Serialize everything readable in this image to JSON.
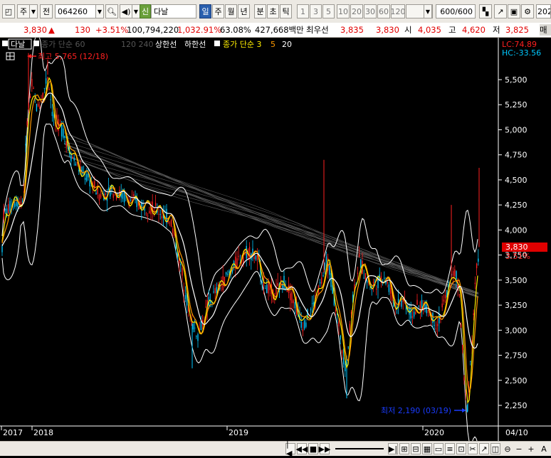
{
  "toolbar": {
    "period_button": "주",
    "prev_button": "전",
    "code_value": "064260",
    "stock_label": "신",
    "stock_name": "다날",
    "periods": [
      "일",
      "주",
      "월",
      "년",
      "분",
      "초",
      "틱"
    ],
    "intervals": [
      "1",
      "3",
      "5",
      "10",
      "20",
      "30",
      "60",
      "120"
    ],
    "count_value": "600",
    "count_total": "/600",
    "date_partial": "202"
  },
  "quote": {
    "price": "3,830",
    "change_arrow": "▲",
    "change": "130",
    "change_pct": "+3.51%",
    "volume": "100,794,220",
    "volume_pct": "1,032.91%",
    "turnover_pct": "63.08%",
    "amount": "427,668백만",
    "best_label": "최우선",
    "ask": "3,835",
    "bid": "3,830",
    "open_label": "시",
    "open": "4,035",
    "high_label": "고",
    "high": "4,620",
    "low_label": "저",
    "low": "3,825",
    "trade_label": "매"
  },
  "chart": {
    "stock_tag": "다날",
    "legend": {
      "price_ma": "종가 단순 60",
      "price_ma_faded": "120 240",
      "upper_limit": "상한선",
      "lower_limit": "하한선",
      "ma_label": "종가 단순 3",
      "ma_5": "5",
      "ma_20": "20"
    },
    "high_annotation": "최고 5,765 (12/18)",
    "low_annotation": "최저 2,190 (03/19)",
    "lc_value": "LC:74.89",
    "hc_value": "HC:-33.56",
    "current_price": "3,830",
    "current_pct": "3.51%",
    "y_ticks": [
      "5,500",
      "5,250",
      "5,000",
      "4,750",
      "4,500",
      "4,250",
      "4,000",
      "3,750",
      "3,500",
      "3,250",
      "3,000",
      "2,750",
      "2,500",
      "2,250"
    ],
    "x_ticks": [
      "2017",
      "2018",
      "2019",
      "2020"
    ],
    "date_label": "04/10",
    "colors": {
      "up": "#ff2020",
      "down": "#00c8ff",
      "ma3": "#ffee00",
      "ma5": "#ff9900",
      "ma20": "#ffffff",
      "envelope": "#ffffff",
      "accent": "#ff0000",
      "annotation_low": "#1a3cff"
    }
  },
  "chart_data": {
    "type": "line",
    "title": "",
    "xlabel": "",
    "ylabel": "",
    "ylim": [
      2100,
      5900
    ],
    "x": [
      "2017",
      "2018",
      "2019",
      "2020"
    ],
    "series": [
      {
        "name": "종가 단순 3",
        "values": [
          4100,
          5000,
          3800,
          3830
        ]
      }
    ],
    "annotations": [
      "최고 5,765 (12/18)",
      "최저 2,190 (03/19)"
    ]
  },
  "status": {
    "a_label": "A",
    "plus_label": "+",
    "minus_label": "−"
  }
}
